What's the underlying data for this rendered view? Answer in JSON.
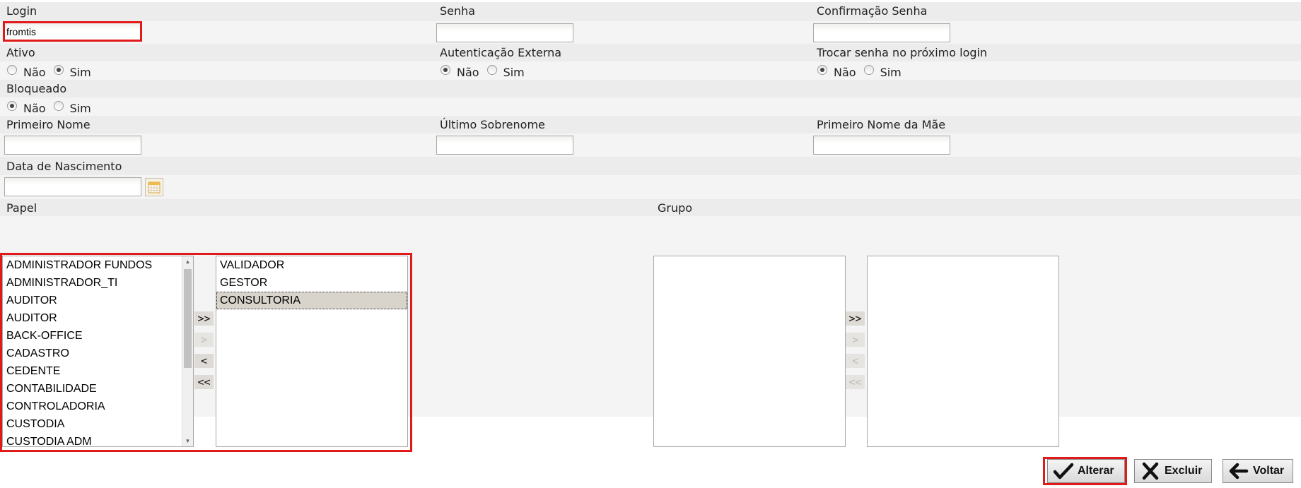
{
  "row1": {
    "login_label": "Login",
    "login_value": "fromtis",
    "senha_label": "Senha",
    "senha_value": "",
    "confirmacao_label": "Confirmação Senha",
    "confirmacao_value": ""
  },
  "row2": {
    "ativo_label": "Ativo",
    "ativo_options": [
      "Não",
      "Sim"
    ],
    "ativo_selected": "Sim",
    "autenticacao_label": "Autenticação Externa",
    "autenticacao_options": [
      "Não",
      "Sim"
    ],
    "autenticacao_selected": "Não",
    "trocar_label": "Trocar senha no próximo login",
    "trocar_options": [
      "Não",
      "Sim"
    ],
    "trocar_selected": "Não"
  },
  "row3": {
    "bloqueado_label": "Bloqueado",
    "bloqueado_options": [
      "Não",
      "Sim"
    ],
    "bloqueado_selected": "Não"
  },
  "row4": {
    "primeiro_nome_label": "Primeiro Nome",
    "ultimo_sobrenome_label": "Último Sobrenome",
    "primeiro_nome_mae_label": "Primeiro Nome da Mãe"
  },
  "row5": {
    "data_nascimento_label": "Data de Nascimento",
    "calendar_icon": "calendar-icon"
  },
  "papel": {
    "label": "Papel",
    "available": [
      "ADMINISTRADOR FUNDOS",
      "ADMINISTRADOR_TI",
      "AUDITOR",
      "AUDITOR",
      "BACK-OFFICE",
      "CADASTRO",
      "CEDENTE",
      "CONTABILIDADE",
      "CONTROLADORIA",
      "CUSTODIA",
      "CUSTODIA ADM"
    ],
    "selected": [
      "VALIDADOR",
      "GESTOR",
      "CONSULTORIA"
    ],
    "highlighted": "CONSULTORIA",
    "buttons": {
      "add_all": ">>",
      "add": ">",
      "remove": "<",
      "remove_all": "<<"
    }
  },
  "grupo": {
    "label": "Grupo",
    "available": [],
    "selected": [],
    "buttons": {
      "add_all": ">>",
      "add": ">",
      "remove": "<",
      "remove_all": "<<"
    }
  },
  "actions": {
    "alterar": "Alterar",
    "excluir": "Excluir",
    "voltar": "Voltar"
  },
  "colors": {
    "highlight": "#e01919",
    "label_band": "#ececec",
    "input_band": "#f4f4f4"
  }
}
